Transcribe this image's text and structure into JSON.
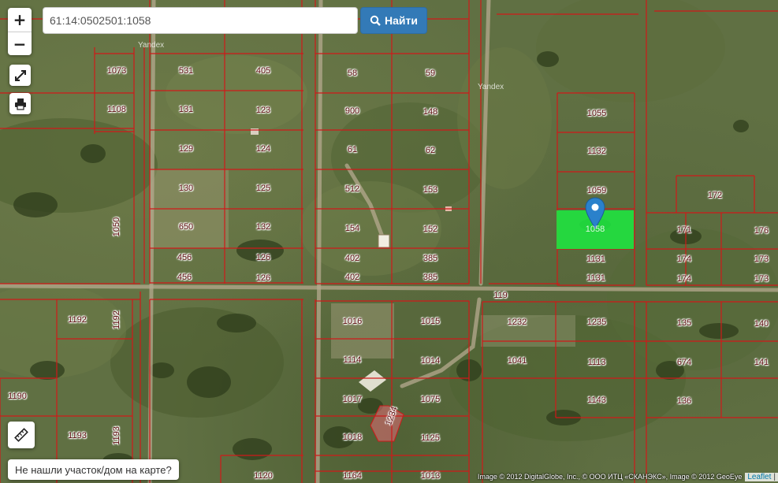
{
  "search": {
    "value": "61:14:0502501:1058",
    "button_label": "Найти",
    "button_icon": "search-icon"
  },
  "controls": {
    "zoom_in": "+",
    "zoom_out": "−",
    "fullscreen_icon": "expand-icon",
    "print_icon": "print-icon",
    "ruler_icon": "ruler-icon"
  },
  "notfound_label": "Не нашли участок/дом на карте?",
  "attribution": {
    "text": "Image © 2012 DigitalGlobe, Inc., © ООО ИТЦ «СКАНЭКС», Image © 2012 GeoEye",
    "leaflet": "Leaflet",
    "sep": "|"
  },
  "watermarks": [
    "Yandex",
    "Yandex"
  ],
  "colors": {
    "parcel_border": "#d01919",
    "selected_fill": "#1ee640",
    "marker": "#2a81cb",
    "road": "#b5a98f"
  },
  "selected_parcel": {
    "number": "1058"
  },
  "parcel_numbers": [
    "1073",
    "531",
    "405",
    "58",
    "59",
    "1108",
    "131",
    "123",
    "900",
    "148",
    "1055",
    "129",
    "124",
    "61",
    "62",
    "1132",
    "130",
    "125",
    "512",
    "153",
    "1059",
    "172",
    "1050",
    "650",
    "132",
    "154",
    "152",
    "171",
    "176",
    "456",
    "126",
    "402",
    "385",
    "1131",
    "174",
    "173",
    "456",
    "126",
    "402",
    "385",
    "1131",
    "174",
    "173",
    "119",
    "1192",
    "1192",
    "1016",
    "1015",
    "1232",
    "1235",
    "135",
    "140",
    "1114",
    "1014",
    "1041",
    "1113",
    "674",
    "141",
    "1190",
    "1017",
    "1075",
    "1143",
    "136",
    "1234",
    "1193",
    "1193",
    "1018",
    "1125",
    "1120",
    "1164",
    "1013"
  ]
}
